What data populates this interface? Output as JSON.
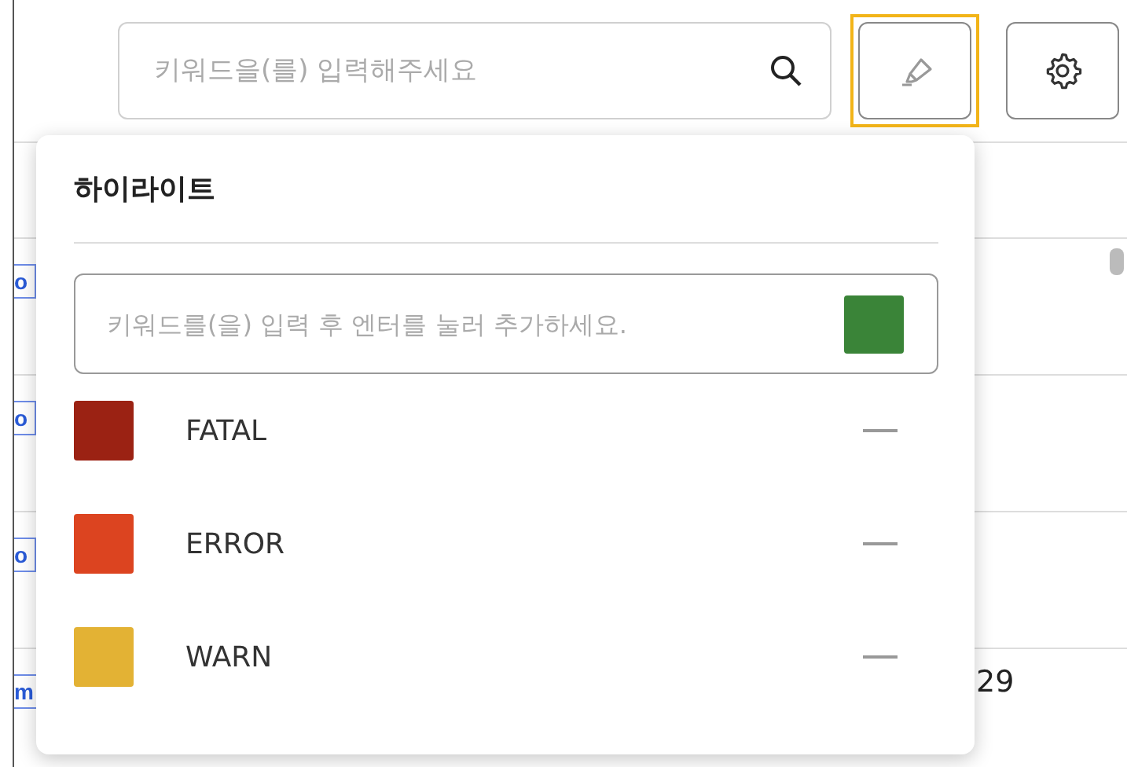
{
  "toolbar": {
    "search": {
      "placeholder": "키워드을(를) 입력해주세요"
    },
    "buttons": [
      {
        "kind": "highlight",
        "selected": true
      },
      {
        "kind": "settings",
        "selected": false
      }
    ]
  },
  "table": {
    "rows": [
      {
        "tag": "o"
      },
      {
        "tag": "o"
      },
      {
        "tag": "o"
      },
      {
        "tag": "m",
        "value": "29"
      }
    ]
  },
  "highlight_panel": {
    "title": "하이라이트",
    "input": {
      "placeholder": "키워드를(을) 입력 후 엔터를 눌러 추가하세요.",
      "color": "#3a8438"
    },
    "items": [
      {
        "label": "FATAL",
        "color": "#9b2213"
      },
      {
        "label": "ERROR",
        "color": "#dc4420"
      },
      {
        "label": "WARN",
        "color": "#e3b234"
      }
    ]
  }
}
